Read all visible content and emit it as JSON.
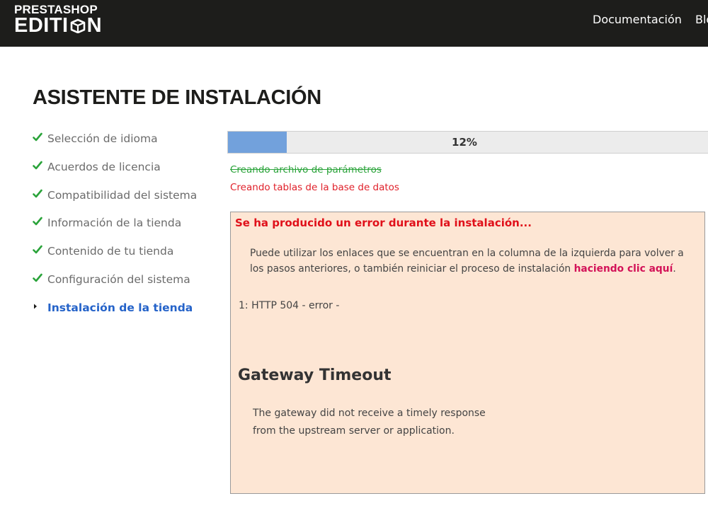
{
  "header": {
    "logo_line1": "PRESTASHOP",
    "logo_line2_a": "EDITI",
    "logo_line2_b": "N",
    "nav": [
      "Documentación",
      "Blog"
    ]
  },
  "page_title": "ASISTENTE DE INSTALACIÓN",
  "steps": [
    {
      "label": "Selección de idioma",
      "status": "done"
    },
    {
      "label": "Acuerdos de licencia",
      "status": "done"
    },
    {
      "label": "Compatibilidad del sistema",
      "status": "done"
    },
    {
      "label": "Información de la tienda",
      "status": "done"
    },
    {
      "label": "Contenido de tu tienda",
      "status": "done"
    },
    {
      "label": "Configuración del sistema",
      "status": "done"
    },
    {
      "label": "Instalación de la tienda",
      "status": "current"
    }
  ],
  "progress": {
    "percent": 12,
    "text": "12%"
  },
  "tasks": {
    "done": "Creando archivo de parámetros",
    "failed": "Creando tablas de la base de datos"
  },
  "error": {
    "title": "Se ha producido un error durante la instalación...",
    "description": "Puede utilizar los enlaces que se encuentran en la columna de la izquierda para volver a los pasos anteriores, o también reiniciar el proceso de instalación ",
    "link": "haciendo clic aquí",
    "description_end": ".",
    "http_code": "1: HTTP 504",
    "http_sep1": " - ",
    "http_status": "error",
    "http_sep2": " -",
    "gateway_title": "Gateway Timeout",
    "gateway_line1": "The gateway did not receive a timely response",
    "gateway_line2": "from the upstream server or application."
  },
  "colors": {
    "header_bg": "#1d1d1b",
    "check": "#2aa33a",
    "current_step": "#2563c9",
    "progress_fill": "#72a1dc",
    "error_text": "#e0101a",
    "error_bg": "#fde6d4",
    "link": "#d31358"
  }
}
